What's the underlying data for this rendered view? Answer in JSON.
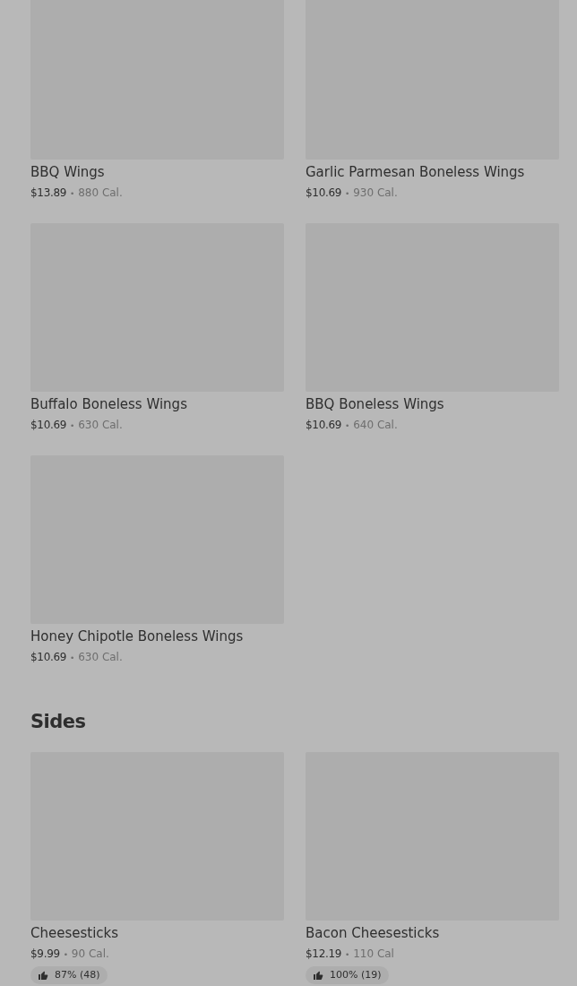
{
  "sections": [
    {
      "items": [
        {
          "name": "BBQ Wings",
          "price": "$13.89",
          "separator": "•",
          "calories": "880 Cal."
        },
        {
          "name": "Garlic Parmesan Boneless Wings",
          "price": "$10.69",
          "separator": "•",
          "calories": "930 Cal."
        },
        {
          "name": "Buffalo Boneless Wings",
          "price": "$10.69",
          "separator": "•",
          "calories": "630 Cal."
        },
        {
          "name": "BBQ Boneless Wings",
          "price": "$10.69",
          "separator": "•",
          "calories": "640 Cal."
        },
        {
          "name": "Honey Chipotle Boneless Wings",
          "price": "$10.69",
          "separator": "•",
          "calories": "630 Cal."
        }
      ]
    },
    {
      "title": "Sides",
      "items": [
        {
          "name": "Cheesesticks",
          "price": "$9.99",
          "separator": "•",
          "calories": "90 Cal.",
          "rating": "87% (48)"
        },
        {
          "name": "Bacon Cheesesticks",
          "price": "$12.19",
          "separator": "•",
          "calories": "110 Cal",
          "rating": "100% (19)"
        }
      ]
    }
  ]
}
